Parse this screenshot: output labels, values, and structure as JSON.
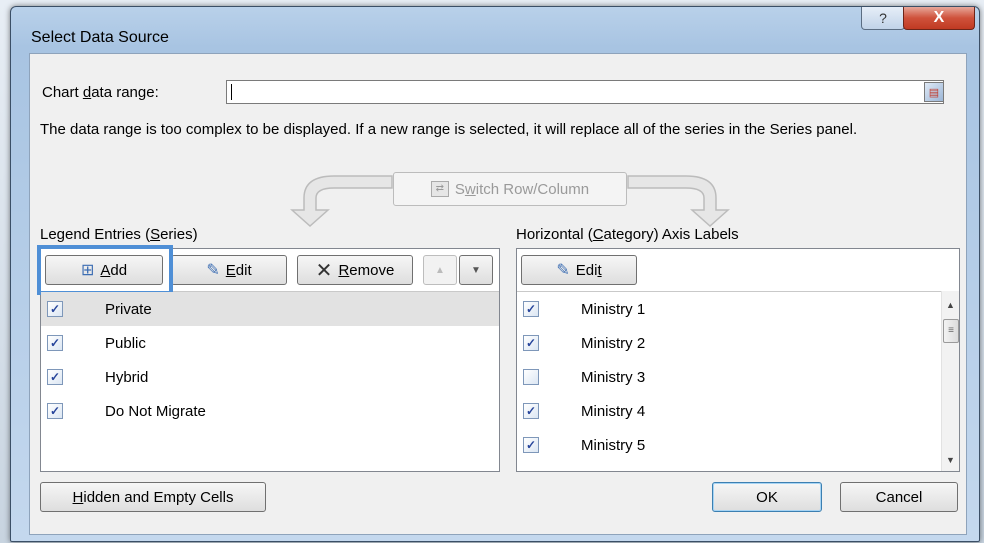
{
  "window": {
    "title": "Select Data Source",
    "help_glyph": "?",
    "close_glyph": "X"
  },
  "range": {
    "label_pre": "Chart ",
    "label_accel": "d",
    "label_post": "ata range:",
    "value": ""
  },
  "message": "The data range is too complex to be displayed. If a new range is selected, it will replace all of the series in the Series panel.",
  "switch": {
    "pre": "S",
    "accel": "w",
    "post": "itch Row/Column"
  },
  "legend": {
    "title_pre": "Legend Entries (",
    "title_accel": "S",
    "title_post": "eries)",
    "buttons": {
      "add": {
        "accel": "A",
        "post": "dd"
      },
      "edit": {
        "accel": "E",
        "post": "dit"
      },
      "remove": {
        "accel": "R",
        "post": "emove"
      },
      "up_glyph": "▲",
      "down_glyph": "▼"
    },
    "items": [
      {
        "label": "Private",
        "checked": true
      },
      {
        "label": "Public",
        "checked": true
      },
      {
        "label": "Hybrid",
        "checked": true
      },
      {
        "label": "Do Not Migrate",
        "checked": true
      }
    ]
  },
  "category": {
    "title_pre": "Horizontal (",
    "title_accel": "C",
    "title_post": "ategory) Axis Labels",
    "edit": {
      "pre": "Edi",
      "accel": "t"
    },
    "items": [
      {
        "label": "Ministry 1",
        "checked": true
      },
      {
        "label": "Ministry 2",
        "checked": true
      },
      {
        "label": "Ministry 3",
        "checked": false
      },
      {
        "label": "Ministry 4",
        "checked": true
      },
      {
        "label": "Ministry 5",
        "checked": true
      }
    ]
  },
  "footer": {
    "hidden": {
      "accel": "H",
      "post": "idden and Empty Cells"
    },
    "ok": "OK",
    "cancel": "Cancel"
  },
  "icons": {
    "add": "add-series-icon",
    "edit": "edit-icon",
    "remove": "remove-x-icon",
    "picker": "range-picker-icon",
    "switch": "switch-row-column-icon",
    "check": "✓"
  },
  "colors": {
    "highlight": "#4f8fd6",
    "close": "#c03a22",
    "titlebar": "#b9d1ea"
  }
}
